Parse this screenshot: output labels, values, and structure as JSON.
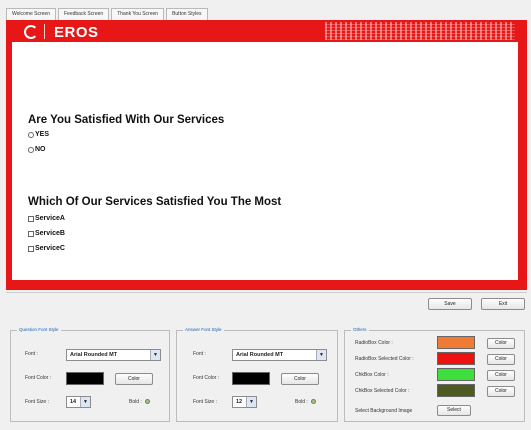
{
  "tabs": [
    "Welcome Screen",
    "Feedback Screen",
    "Thank You Screen",
    "Button Styles"
  ],
  "brand": {
    "logo_text": "EROS"
  },
  "question1": {
    "title": "Are You Satisfied With Our Services",
    "options": [
      "YES",
      "NO"
    ]
  },
  "question2": {
    "title": "Which Of Our Services Satisfied You The Most",
    "options": [
      "ServiceA",
      "ServiceB",
      "ServiceC"
    ]
  },
  "actions": {
    "save_label": "Save",
    "exit_label": "Exit"
  },
  "question_font_style": {
    "legend": "Question Font Style",
    "font_label": "Font :",
    "font_value": "Arial Rounded MT",
    "font_color_label": "Font Color :",
    "font_color": "#000000",
    "color_button": "Color",
    "font_size_label": "Font Size :",
    "font_size_value": "14",
    "bold_label": "Bold :"
  },
  "answer_font_style": {
    "legend": "Answer Font Style",
    "font_label": "Font :",
    "font_value": "Arial Rounded MT",
    "font_color_label": "Font Color :",
    "font_color": "#000000",
    "color_button": "Color",
    "font_size_label": "Font Size :",
    "font_size_value": "12",
    "bold_label": "Bold :"
  },
  "others": {
    "legend": "Others",
    "rows": [
      {
        "label": "RadioBox Color :",
        "color": "#f07b35",
        "button": "Color"
      },
      {
        "label": "RadioBox Selected Color :",
        "color": "#ee1111",
        "button": "Color"
      },
      {
        "label": "ChkBox Color :",
        "color": "#3ddf3d",
        "button": "Color"
      },
      {
        "label": "ChkBox Selected Color :",
        "color": "#4d5a22",
        "button": "Color"
      }
    ],
    "bg_image_label": "Select Background Image",
    "select_button": "Select"
  },
  "colors": {
    "preview_frame": "#e81717"
  }
}
